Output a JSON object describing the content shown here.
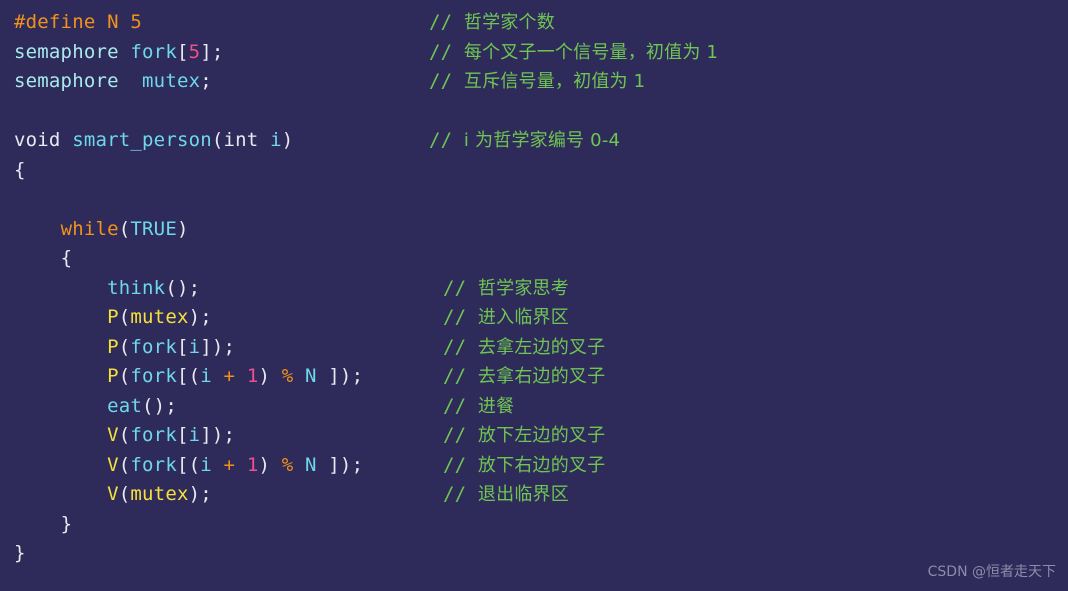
{
  "editor": {
    "language": "C",
    "background_color": "#2e2b5b",
    "title": "Dining philosophers semaphore solution"
  },
  "colors": {
    "background": "#2e2b5b",
    "preprocessor": "#f2911b",
    "keyword": "#f2911b",
    "operator": "#f2911b",
    "type": "#a8eaea",
    "identifier": "#6fd8e8",
    "number": "#f0508c",
    "semaphore_call": "#f5e03c",
    "punctuation": "#e9e9ef",
    "comment": "#6fc552",
    "watermark": "#9b99b4"
  },
  "code": {
    "lines": [
      {
        "n": 1,
        "text": "#define N 5",
        "tokens": [
          {
            "t": "#define N 5",
            "c": "t-pre"
          }
        ],
        "comment": "// 哲学家个数"
      },
      {
        "n": 2,
        "text": "semaphore fork[5];",
        "tokens": [
          {
            "t": "semaphore",
            "c": "t-type"
          },
          {
            "t": " ",
            "c": "t-plain"
          },
          {
            "t": "fork",
            "c": "t-id"
          },
          {
            "t": "[",
            "c": "t-punc"
          },
          {
            "t": "5",
            "c": "t-num"
          },
          {
            "t": "];",
            "c": "t-punc"
          }
        ],
        "comment": "// 每个叉子一个信号量，初值为 1"
      },
      {
        "n": 3,
        "text": "semaphore  mutex;",
        "tokens": [
          {
            "t": "semaphore",
            "c": "t-type"
          },
          {
            "t": "  ",
            "c": "t-plain"
          },
          {
            "t": "mutex",
            "c": "t-id"
          },
          {
            "t": ";",
            "c": "t-punc"
          }
        ],
        "comment": "// 互斥信号量，初值为 1"
      },
      {
        "n": 4,
        "text": "",
        "tokens": [],
        "comment": ""
      },
      {
        "n": 5,
        "text": "void smart_person(int i)",
        "tokens": [
          {
            "t": "void",
            "c": "t-plain"
          },
          {
            "t": " ",
            "c": "t-plain"
          },
          {
            "t": "smart_person",
            "c": "t-fn"
          },
          {
            "t": "(",
            "c": "t-punc"
          },
          {
            "t": "int",
            "c": "t-plain"
          },
          {
            "t": " ",
            "c": "t-plain"
          },
          {
            "t": "i",
            "c": "t-id"
          },
          {
            "t": ")",
            "c": "t-punc"
          }
        ],
        "comment": "// i 为哲学家编号 0-4"
      },
      {
        "n": 6,
        "text": "{",
        "tokens": [
          {
            "t": "{",
            "c": "t-punc"
          }
        ],
        "comment": ""
      },
      {
        "n": 7,
        "text": "",
        "tokens": [],
        "comment": ""
      },
      {
        "n": 8,
        "text": "    while(TRUE)",
        "tokens": [
          {
            "t": "    ",
            "c": "t-plain"
          },
          {
            "t": "while",
            "c": "t-kw"
          },
          {
            "t": "(",
            "c": "t-punc"
          },
          {
            "t": "TRUE",
            "c": "t-id"
          },
          {
            "t": ")",
            "c": "t-punc"
          }
        ],
        "comment": ""
      },
      {
        "n": 9,
        "text": "    {",
        "tokens": [
          {
            "t": "    ",
            "c": "t-plain"
          },
          {
            "t": "{",
            "c": "t-punc"
          }
        ],
        "comment": ""
      },
      {
        "n": 10,
        "text": "        think();",
        "tokens": [
          {
            "t": "        ",
            "c": "t-plain"
          },
          {
            "t": "think",
            "c": "t-fn"
          },
          {
            "t": "();",
            "c": "t-punc"
          }
        ],
        "comment": "// 哲学家思考"
      },
      {
        "n": 11,
        "text": "        P(mutex);",
        "tokens": [
          {
            "t": "        ",
            "c": "t-plain"
          },
          {
            "t": "P",
            "c": "t-sem"
          },
          {
            "t": "(",
            "c": "t-punc"
          },
          {
            "t": "mutex",
            "c": "t-sem"
          },
          {
            "t": ");",
            "c": "t-punc"
          }
        ],
        "comment": "// 进入临界区"
      },
      {
        "n": 12,
        "text": "        P(fork[i]);",
        "tokens": [
          {
            "t": "        ",
            "c": "t-plain"
          },
          {
            "t": "P",
            "c": "t-sem"
          },
          {
            "t": "(",
            "c": "t-punc"
          },
          {
            "t": "fork",
            "c": "t-id"
          },
          {
            "t": "[",
            "c": "t-punc"
          },
          {
            "t": "i",
            "c": "t-id"
          },
          {
            "t": "]);",
            "c": "t-punc"
          }
        ],
        "comment": "// 去拿左边的叉子"
      },
      {
        "n": 13,
        "text": "        P(fork[(i + 1) % N ]);",
        "tokens": [
          {
            "t": "        ",
            "c": "t-plain"
          },
          {
            "t": "P",
            "c": "t-sem"
          },
          {
            "t": "(",
            "c": "t-punc"
          },
          {
            "t": "fork",
            "c": "t-id"
          },
          {
            "t": "[(",
            "c": "t-punc"
          },
          {
            "t": "i",
            "c": "t-id"
          },
          {
            "t": " ",
            "c": "t-plain"
          },
          {
            "t": "+",
            "c": "t-op"
          },
          {
            "t": " ",
            "c": "t-plain"
          },
          {
            "t": "1",
            "c": "t-num"
          },
          {
            "t": ") ",
            "c": "t-punc"
          },
          {
            "t": "%",
            "c": "t-op"
          },
          {
            "t": " ",
            "c": "t-plain"
          },
          {
            "t": "N",
            "c": "t-id"
          },
          {
            "t": " ]);",
            "c": "t-punc"
          }
        ],
        "comment": "// 去拿右边的叉子"
      },
      {
        "n": 14,
        "text": "        eat();",
        "tokens": [
          {
            "t": "        ",
            "c": "t-plain"
          },
          {
            "t": "eat",
            "c": "t-fn"
          },
          {
            "t": "();",
            "c": "t-punc"
          }
        ],
        "comment": "// 进餐"
      },
      {
        "n": 15,
        "text": "        V(fork[i]);",
        "tokens": [
          {
            "t": "        ",
            "c": "t-plain"
          },
          {
            "t": "V",
            "c": "t-sem"
          },
          {
            "t": "(",
            "c": "t-punc"
          },
          {
            "t": "fork",
            "c": "t-id"
          },
          {
            "t": "[",
            "c": "t-punc"
          },
          {
            "t": "i",
            "c": "t-id"
          },
          {
            "t": "]);",
            "c": "t-punc"
          }
        ],
        "comment": "// 放下左边的叉子"
      },
      {
        "n": 16,
        "text": "        V(fork[(i + 1) % N ]);",
        "tokens": [
          {
            "t": "        ",
            "c": "t-plain"
          },
          {
            "t": "V",
            "c": "t-sem"
          },
          {
            "t": "(",
            "c": "t-punc"
          },
          {
            "t": "fork",
            "c": "t-id"
          },
          {
            "t": "[(",
            "c": "t-punc"
          },
          {
            "t": "i",
            "c": "t-id"
          },
          {
            "t": " ",
            "c": "t-plain"
          },
          {
            "t": "+",
            "c": "t-op"
          },
          {
            "t": " ",
            "c": "t-plain"
          },
          {
            "t": "1",
            "c": "t-num"
          },
          {
            "t": ") ",
            "c": "t-punc"
          },
          {
            "t": "%",
            "c": "t-op"
          },
          {
            "t": " ",
            "c": "t-plain"
          },
          {
            "t": "N",
            "c": "t-id"
          },
          {
            "t": " ]);",
            "c": "t-punc"
          }
        ],
        "comment": "// 放下右边的叉子"
      },
      {
        "n": 17,
        "text": "        V(mutex);",
        "tokens": [
          {
            "t": "        ",
            "c": "t-plain"
          },
          {
            "t": "V",
            "c": "t-sem"
          },
          {
            "t": "(",
            "c": "t-punc"
          },
          {
            "t": "mutex",
            "c": "t-sem"
          },
          {
            "t": ");",
            "c": "t-punc"
          }
        ],
        "comment": "// 退出临界区"
      },
      {
        "n": 18,
        "text": "    }",
        "tokens": [
          {
            "t": "    ",
            "c": "t-plain"
          },
          {
            "t": "}",
            "c": "t-punc"
          }
        ],
        "comment": ""
      },
      {
        "n": 19,
        "text": "}",
        "tokens": [
          {
            "t": "}",
            "c": "t-punc"
          }
        ],
        "comment": ""
      }
    ],
    "comment_column_x": [
      429,
      429,
      429,
      null,
      429,
      null,
      null,
      null,
      null,
      443,
      443,
      443,
      443,
      443,
      443,
      443,
      443,
      null,
      null
    ]
  },
  "watermark": {
    "text": "CSDN @恒者走天下"
  }
}
